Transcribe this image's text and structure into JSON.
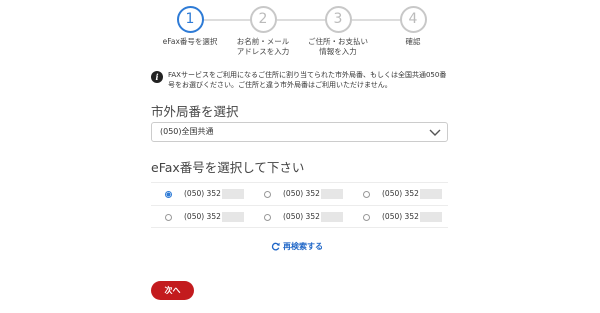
{
  "stepper": {
    "steps": [
      {
        "number": "1",
        "label": "eFax番号を選択"
      },
      {
        "number": "2",
        "label": "お名前・メール\nアドレスを入力"
      },
      {
        "number": "3",
        "label": "ご住所・お支払い\n情報を入力"
      },
      {
        "number": "4",
        "label": "確認"
      }
    ],
    "active_color": "#2e7bd6",
    "inactive_color": "#c8c8c8"
  },
  "notice": {
    "icon": "info-icon",
    "text": "FAXサービスをご利用になるご住所に割り当てられた市外局番、もしくは全国共通050番号をお選びください。ご住所と違う市外局番はご利用いただけません。"
  },
  "area_code": {
    "heading": "市外局番を選択",
    "selected": "(050)全国共通"
  },
  "efax_numbers": {
    "heading": "eFax番号を選択して下さい",
    "rows": [
      [
        {
          "number": "(050) 352",
          "checked": true
        },
        {
          "number": "(050) 352",
          "checked": false
        },
        {
          "number": "(050) 352",
          "checked": false
        }
      ],
      [
        {
          "number": "(050) 352",
          "checked": false
        },
        {
          "number": "(050) 352",
          "checked": false
        },
        {
          "number": "(050) 352",
          "checked": false
        }
      ]
    ]
  },
  "research": {
    "icon": "refresh-icon",
    "label": "再検索する",
    "color": "#1f66c7"
  },
  "next_button": {
    "label": "次へ",
    "color": "#c31b1e"
  }
}
